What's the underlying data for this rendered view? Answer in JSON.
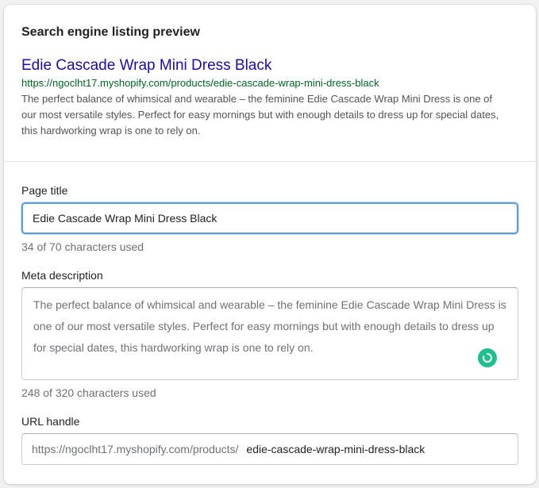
{
  "preview": {
    "section_title": "Search engine listing preview",
    "title": "Edie Cascade Wrap Mini Dress Black",
    "url": "https://ngoclht17.myshopify.com/products/edie-cascade-wrap-mini-dress-black",
    "description": "The perfect balance of whimsical and wearable – the feminine Edie Cascade Wrap Mini Dress is one of our most versatile styles. Perfect for easy mornings but with enough details to dress up for special dates, this hardworking wrap is one to rely on."
  },
  "page_title": {
    "label": "Page title",
    "value": "Edie Cascade Wrap Mini Dress Black",
    "help": "34 of 70 characters used"
  },
  "meta_description": {
    "label": "Meta description",
    "value": "The perfect balance of whimsical and wearable – the feminine Edie Cascade Wrap Mini Dress is one of our most versatile styles. Perfect for easy mornings but with enough details to dress up for special dates, this hardworking wrap is one to rely on.",
    "help": "248 of 320 characters used"
  },
  "url_handle": {
    "label": "URL handle",
    "prefix": "https://ngoclht17.myshopify.com/products/",
    "value": "edie-cascade-wrap-mini-dress-black"
  },
  "colors": {
    "link": "#1a0dab",
    "url_green": "#006621",
    "focus_blue": "#5c9bdc",
    "grammar_badge": "#1fbf8f"
  },
  "icons": {
    "grammar_badge": "grammarly-icon"
  }
}
